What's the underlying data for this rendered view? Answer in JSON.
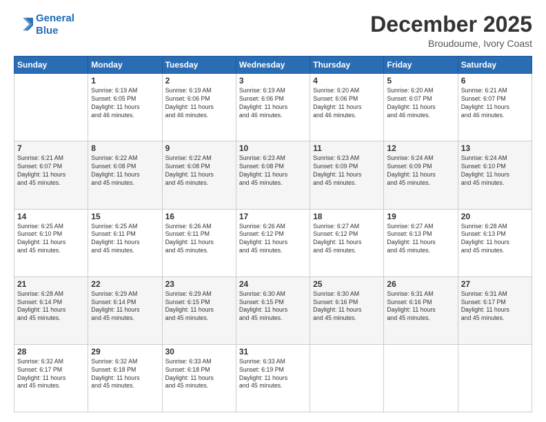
{
  "header": {
    "logo_line1": "General",
    "logo_line2": "Blue",
    "month": "December 2025",
    "location": "Broudoume, Ivory Coast"
  },
  "weekdays": [
    "Sunday",
    "Monday",
    "Tuesday",
    "Wednesday",
    "Thursday",
    "Friday",
    "Saturday"
  ],
  "weeks": [
    [
      {
        "day": "",
        "info": ""
      },
      {
        "day": "1",
        "info": "Sunrise: 6:19 AM\nSunset: 6:05 PM\nDaylight: 11 hours\nand 46 minutes."
      },
      {
        "day": "2",
        "info": "Sunrise: 6:19 AM\nSunset: 6:06 PM\nDaylight: 11 hours\nand 46 minutes."
      },
      {
        "day": "3",
        "info": "Sunrise: 6:19 AM\nSunset: 6:06 PM\nDaylight: 11 hours\nand 46 minutes."
      },
      {
        "day": "4",
        "info": "Sunrise: 6:20 AM\nSunset: 6:06 PM\nDaylight: 11 hours\nand 46 minutes."
      },
      {
        "day": "5",
        "info": "Sunrise: 6:20 AM\nSunset: 6:07 PM\nDaylight: 11 hours\nand 46 minutes."
      },
      {
        "day": "6",
        "info": "Sunrise: 6:21 AM\nSunset: 6:07 PM\nDaylight: 11 hours\nand 46 minutes."
      }
    ],
    [
      {
        "day": "7",
        "info": "Sunrise: 6:21 AM\nSunset: 6:07 PM\nDaylight: 11 hours\nand 45 minutes."
      },
      {
        "day": "8",
        "info": "Sunrise: 6:22 AM\nSunset: 6:08 PM\nDaylight: 11 hours\nand 45 minutes."
      },
      {
        "day": "9",
        "info": "Sunrise: 6:22 AM\nSunset: 6:08 PM\nDaylight: 11 hours\nand 45 minutes."
      },
      {
        "day": "10",
        "info": "Sunrise: 6:23 AM\nSunset: 6:08 PM\nDaylight: 11 hours\nand 45 minutes."
      },
      {
        "day": "11",
        "info": "Sunrise: 6:23 AM\nSunset: 6:09 PM\nDaylight: 11 hours\nand 45 minutes."
      },
      {
        "day": "12",
        "info": "Sunrise: 6:24 AM\nSunset: 6:09 PM\nDaylight: 11 hours\nand 45 minutes."
      },
      {
        "day": "13",
        "info": "Sunrise: 6:24 AM\nSunset: 6:10 PM\nDaylight: 11 hours\nand 45 minutes."
      }
    ],
    [
      {
        "day": "14",
        "info": "Sunrise: 6:25 AM\nSunset: 6:10 PM\nDaylight: 11 hours\nand 45 minutes."
      },
      {
        "day": "15",
        "info": "Sunrise: 6:25 AM\nSunset: 6:11 PM\nDaylight: 11 hours\nand 45 minutes."
      },
      {
        "day": "16",
        "info": "Sunrise: 6:26 AM\nSunset: 6:11 PM\nDaylight: 11 hours\nand 45 minutes."
      },
      {
        "day": "17",
        "info": "Sunrise: 6:26 AM\nSunset: 6:12 PM\nDaylight: 11 hours\nand 45 minutes."
      },
      {
        "day": "18",
        "info": "Sunrise: 6:27 AM\nSunset: 6:12 PM\nDaylight: 11 hours\nand 45 minutes."
      },
      {
        "day": "19",
        "info": "Sunrise: 6:27 AM\nSunset: 6:13 PM\nDaylight: 11 hours\nand 45 minutes."
      },
      {
        "day": "20",
        "info": "Sunrise: 6:28 AM\nSunset: 6:13 PM\nDaylight: 11 hours\nand 45 minutes."
      }
    ],
    [
      {
        "day": "21",
        "info": "Sunrise: 6:28 AM\nSunset: 6:14 PM\nDaylight: 11 hours\nand 45 minutes."
      },
      {
        "day": "22",
        "info": "Sunrise: 6:29 AM\nSunset: 6:14 PM\nDaylight: 11 hours\nand 45 minutes."
      },
      {
        "day": "23",
        "info": "Sunrise: 6:29 AM\nSunset: 6:15 PM\nDaylight: 11 hours\nand 45 minutes."
      },
      {
        "day": "24",
        "info": "Sunrise: 6:30 AM\nSunset: 6:15 PM\nDaylight: 11 hours\nand 45 minutes."
      },
      {
        "day": "25",
        "info": "Sunrise: 6:30 AM\nSunset: 6:16 PM\nDaylight: 11 hours\nand 45 minutes."
      },
      {
        "day": "26",
        "info": "Sunrise: 6:31 AM\nSunset: 6:16 PM\nDaylight: 11 hours\nand 45 minutes."
      },
      {
        "day": "27",
        "info": "Sunrise: 6:31 AM\nSunset: 6:17 PM\nDaylight: 11 hours\nand 45 minutes."
      }
    ],
    [
      {
        "day": "28",
        "info": "Sunrise: 6:32 AM\nSunset: 6:17 PM\nDaylight: 11 hours\nand 45 minutes."
      },
      {
        "day": "29",
        "info": "Sunrise: 6:32 AM\nSunset: 6:18 PM\nDaylight: 11 hours\nand 45 minutes."
      },
      {
        "day": "30",
        "info": "Sunrise: 6:33 AM\nSunset: 6:18 PM\nDaylight: 11 hours\nand 45 minutes."
      },
      {
        "day": "31",
        "info": "Sunrise: 6:33 AM\nSunset: 6:19 PM\nDaylight: 11 hours\nand 45 minutes."
      },
      {
        "day": "",
        "info": ""
      },
      {
        "day": "",
        "info": ""
      },
      {
        "day": "",
        "info": ""
      }
    ]
  ]
}
